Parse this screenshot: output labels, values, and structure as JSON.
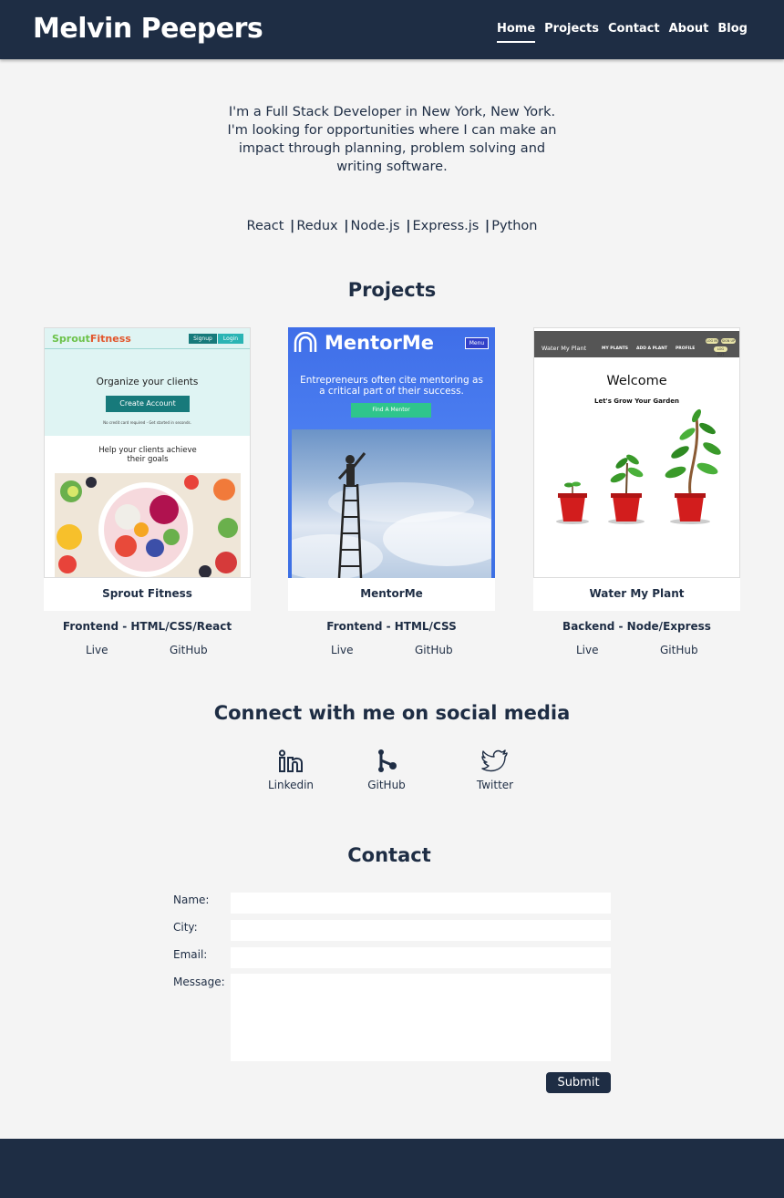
{
  "header": {
    "brand": "Melvin Peepers",
    "nav": [
      {
        "label": "Home",
        "active": true
      },
      {
        "label": "Projects",
        "active": false
      },
      {
        "label": "Contact",
        "active": false
      },
      {
        "label": "About",
        "active": false
      },
      {
        "label": "Blog",
        "active": false
      }
    ]
  },
  "intro": {
    "text": "I'm a Full Stack Developer in New York, New York. I'm looking for opportunities where I can make an impact through planning, problem solving and writing software.",
    "skills": [
      "React",
      "Redux",
      "Node.js",
      "Express.js",
      "Python"
    ]
  },
  "projects": {
    "title": "Projects",
    "items": [
      {
        "name": "Sprout Fitness",
        "stack": "Frontend - HTML/CSS/React",
        "live_label": "Live",
        "github_label": "GitHub",
        "thumb": {
          "logo_a": "Sprout",
          "logo_b": "Fitness",
          "signup": "Signup",
          "login": "Login",
          "headline": "Organize your clients",
          "cta": "Create Account",
          "fine_print": "No credit card required - Get started in seconds.",
          "subhead": "Help your clients achieve their goals"
        }
      },
      {
        "name": "MentorMe",
        "stack": "Frontend - HTML/CSS",
        "live_label": "Live",
        "github_label": "GitHub",
        "thumb": {
          "logo": "MentorMe",
          "menu": "Menu",
          "tagline": "Entrepreneurs often cite mentoring as a critical part of their success.",
          "cta": "Find A Mentor"
        }
      },
      {
        "name": "Water My Plant",
        "stack": "Backend - Node/Express",
        "live_label": "Live",
        "github_label": "GitHub",
        "thumb": {
          "app_title": "Water My Plant",
          "menu": [
            "MY PLANTS",
            "ADD A PLANT",
            "PROFILE"
          ],
          "pills": [
            "LOG IN",
            "SIGN UP",
            "LOG OUT"
          ],
          "welcome": "Welcome",
          "subhead": "Let's Grow Your Garden"
        }
      }
    ]
  },
  "social": {
    "title": "Connect with me on social media",
    "links": [
      {
        "label": "Linkedin",
        "icon": "linkedin-icon"
      },
      {
        "label": "GitHub",
        "icon": "github-icon"
      },
      {
        "label": "Twitter",
        "icon": "twitter-icon"
      }
    ]
  },
  "contact": {
    "title": "Contact",
    "name_label": "Name:",
    "city_label": "City:",
    "email_label": "Email:",
    "message_label": "Message:",
    "name_value": "",
    "city_value": "",
    "email_value": "",
    "message_value": "",
    "submit_label": "Submit"
  },
  "colors": {
    "primary": "#1e2d44",
    "background": "#f4f4f4"
  }
}
